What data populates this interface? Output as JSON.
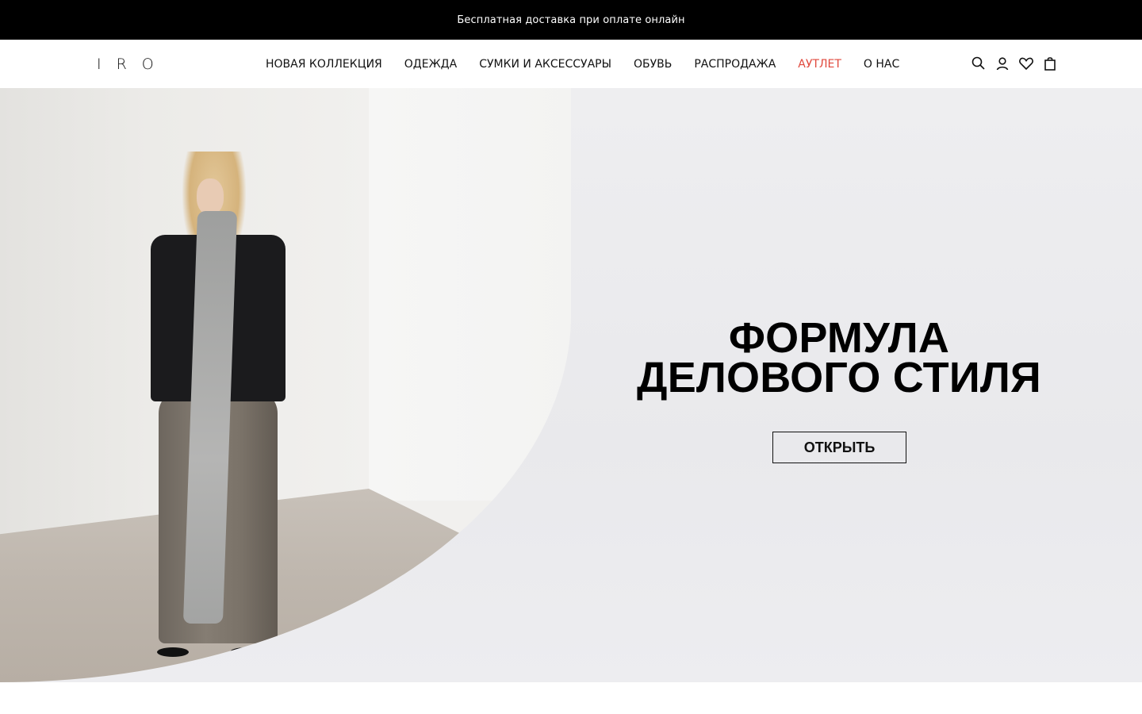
{
  "promo": {
    "text": "Бесплатная доставка при оплате онлайн"
  },
  "header": {
    "logo": "IRO",
    "nav": [
      {
        "label": "НОВАЯ КОЛЛЕКЦИЯ"
      },
      {
        "label": "ОДЕЖДА"
      },
      {
        "label": "СУМКИ И АКСЕССУАРЫ"
      },
      {
        "label": "ОБУВЬ"
      },
      {
        "label": "РАСПРОДАЖА"
      },
      {
        "label": "АУТЛЕТ",
        "accent": true
      },
      {
        "label": "О НАС"
      }
    ],
    "icons": [
      "search-icon",
      "account-icon",
      "wishlist-heart-icon",
      "shopping-bag-icon"
    ]
  },
  "hero": {
    "title_line1": "ФОРМУЛА",
    "title_line2": "ДЕЛОВОГО СТИЛЯ",
    "button_label": "ОТКРЫТЬ"
  },
  "colors": {
    "promo_bg": "#000000",
    "accent_link": "#e0483c",
    "hero_bg": "#ececef"
  }
}
